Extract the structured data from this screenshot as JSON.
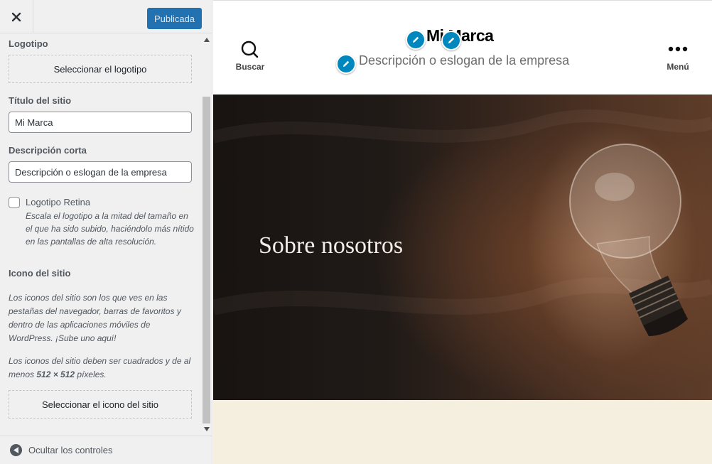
{
  "sidebar": {
    "publish_label": "Publicada",
    "logo": {
      "heading": "Logotipo",
      "select_label": "Seleccionar el logotipo"
    },
    "site_title": {
      "heading": "Título del sitio",
      "value": "Mi Marca"
    },
    "tagline": {
      "heading": "Descripción corta",
      "value": "Descripción o eslogan de la empresa"
    },
    "retina": {
      "label": "Logotipo Retina",
      "checked": false,
      "description": "Escala el logotipo a la mitad del tamaño en el que ha sido subido, haciéndolo más nítido en las pantallas de alta resolución."
    },
    "site_icon": {
      "heading": "Icono del sitio",
      "description_1": "Los iconos del sitio son los que ves en las pestañas del navegador, barras de favoritos y dentro de las aplicaciones móviles de WordPress. ¡Sube uno aquí!",
      "description_2_prefix": "Los iconos del sitio deben ser cuadrados y de al menos ",
      "description_2_size": "512 × 512",
      "description_2_suffix": " píxeles.",
      "select_label": "Seleccionar el icono del sitio"
    },
    "footer_label": "Ocultar los controles"
  },
  "preview": {
    "site_title": "Mi Marca",
    "tagline": "Descripción o eslogan de la empresa",
    "search_label": "Buscar",
    "menu_label": "Menú",
    "hero_title": "Sobre nosotros"
  },
  "colors": {
    "accent": "#2271b1",
    "edit_shortcut": "#0087be",
    "hero_dark": "#141211",
    "below_hero": "#f5efe0"
  },
  "icons": {
    "close": "close-icon",
    "search": "search-icon",
    "menu": "menu-dots-icon",
    "edit": "pencil-icon",
    "hide_controls": "collapse-arrow-icon"
  }
}
